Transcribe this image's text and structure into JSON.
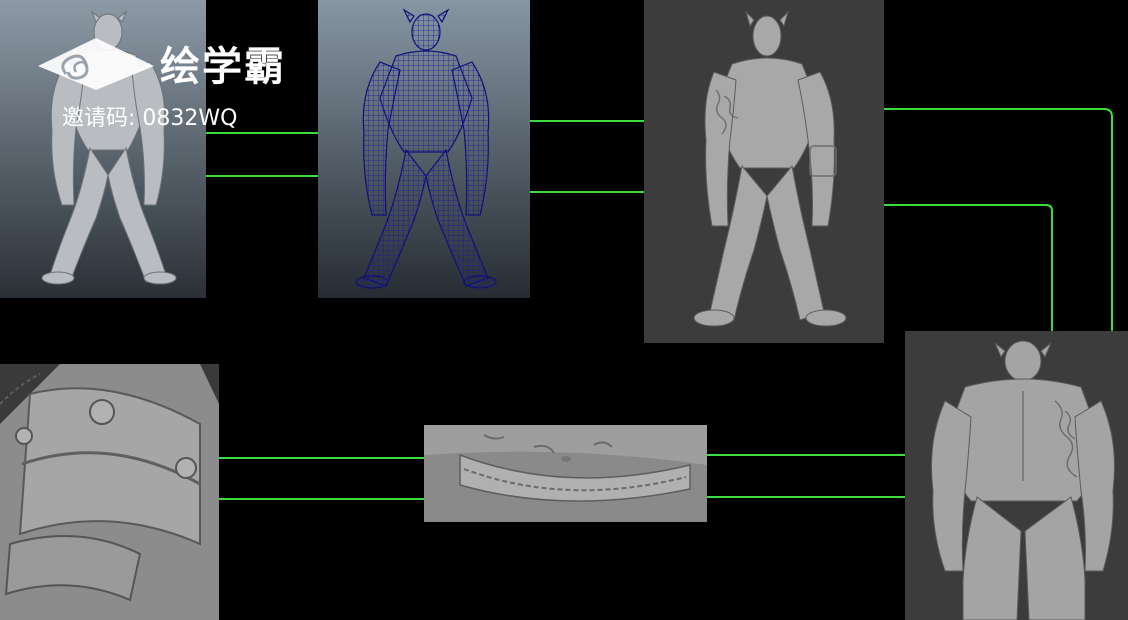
{
  "watermark": {
    "brand": "绘学霸",
    "invite_code": "邀请码: 0832WQ"
  },
  "panels": [
    {
      "id": "shaded-front-view",
      "icon": "figure-front-smooth"
    },
    {
      "id": "wireframe-front-view",
      "icon": "figure-front-wireframe"
    },
    {
      "id": "sculpt-front-view",
      "icon": "figure-front-sculpt"
    },
    {
      "id": "arm-band-closeup",
      "icon": "armband-detail"
    },
    {
      "id": "waist-seam-closeup",
      "icon": "waist-detail"
    },
    {
      "id": "sculpt-back-view",
      "icon": "figure-back-sculpt"
    }
  ],
  "colors": {
    "connector": "#3ddc3d",
    "wireframe": "#1a1aa0",
    "background": "#000000"
  }
}
